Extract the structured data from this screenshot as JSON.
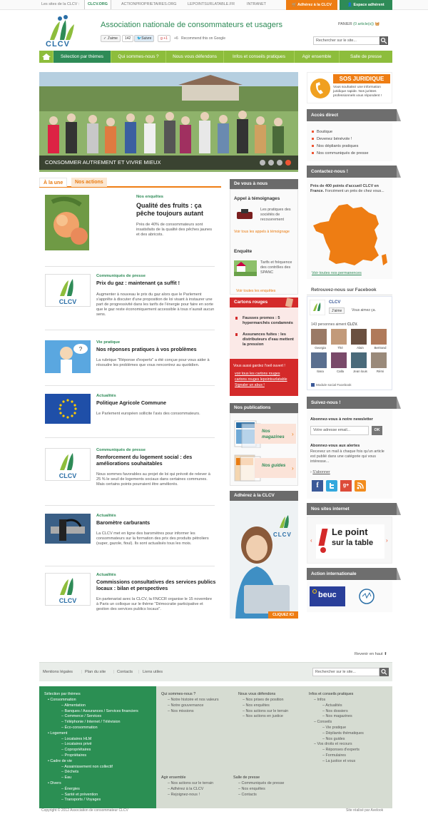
{
  "topbar": {
    "sites_label": "Les sites de la CLCV :",
    "links": [
      "CLCV.ORG",
      "ACTIONPROPRIETAIRES.ORG",
      "LEPOINTSURLATABLE.FR",
      "INTRANET"
    ],
    "adherez": "Adhérez à la CLCV",
    "espace": "Espace adhérent"
  },
  "header": {
    "logo_text": "CLCV",
    "site_title": "Association nationale de consommateurs et usagers",
    "jaime": "J'aime",
    "jaime_count": "142",
    "suivre": "Suivre",
    "gplus": "+1",
    "gplus_count": "+6",
    "recommend": "Recommend this on Google",
    "panier_label": "PANIER",
    "panier_value": "(0 article(s))",
    "search_placeholder": "Rechercher sur le site..."
  },
  "nav": {
    "items": [
      "Sélection par thèmes",
      "Qui sommes-nous ?",
      "Nous vous défendons",
      "Infos et conseils pratiques",
      "Agir ensemble",
      "Salle de presse"
    ]
  },
  "hero": {
    "caption": "CONSOMMER AUTREMENT ET VIVRE MIEUX"
  },
  "tabs": [
    "À la une",
    "Nos actions"
  ],
  "articles": [
    {
      "category": "Nos enquêtes",
      "title": "Qualité des fruits : ça pêche toujours autant",
      "desc": "Près de 40% de consommateurs sont insatisfaits de la qualité des pêches jaunes et des abricots."
    },
    {
      "category": "Communiqués de presse",
      "title": "Prix du gaz : maintenant ça suffit !",
      "desc": "Augmenter à nouveau le prix du gaz alors que le Parlement s'apprête à discuter d'une proposition de loi visant à instaurer une part de progressivité dans les tarifs de l'énergie pour faire en sorte que le gaz reste économiquement accessible à tous n'aurait aucun sens."
    },
    {
      "category": "Vie pratique",
      "title": "Nos réponses pratiques à vos problèmes",
      "desc": "La rubrique \"Réponse d'experts\" a été conçue pour vous aider à résoudre les problèmes que vous rencontrez au quotidien."
    },
    {
      "category": "Actualités",
      "title": "Politique Agricole Commune",
      "desc": "Le Parlement européen sollicite l'avis des consommateurs."
    },
    {
      "category": "Communiqués de presse",
      "title": "Renforcement du logement social : des améliorations souhaitables",
      "desc": "Nous sommes favorables au projet de loi qui prévoit de relever à 25 % le seuil de logements sociaux dans certaines communes. Mais certains points pourraient être améliorés."
    },
    {
      "category": "Actualités",
      "title": "Baromètre carburants",
      "desc": "La CLCV met en ligne des baromètres pour informer les consommateurs sur la formation des prix des produits pétroliers (super, gazole, fioul). Ils sont actualisés tous les mois."
    },
    {
      "category": "Actualités",
      "title": "Commissions consultatives des services publics locaux : bilan et perspectives",
      "desc": "En partenariat avec la CLCV, la FNCCR organise le 15 novembre à Paris un colloque sur le thème \"Démocratie participative et gestion des services publics locaux\"."
    }
  ],
  "de_vous": {
    "heading": "De vous à nous",
    "appel_title": "Appel à témoignages",
    "appel_text": "Les pratiques des sociétés de recouvrement",
    "appel_link": "Voir tous les appels à témoignage",
    "enquete_title": "Enquête",
    "enquete_text": "Tarifs et fréquence des contrôles des SPANC",
    "enquete_link": "Voir toutes les enquêtes"
  },
  "cartons": {
    "heading": "Cartons rouges",
    "items": [
      "Fausses promos : 5 hypermarchés condamnés",
      "Assurances fuites : les distributeurs d'eau mettent la pression"
    ],
    "note": "Vous aussi gardez l'oeil ouvert !",
    "links": [
      "voir tous les cartons rouges",
      "cartons rouges lepointsurlatable",
      "Signaler un abus !"
    ]
  },
  "publications": {
    "heading": "Nos publications",
    "items": [
      "Nos magazines",
      "Nos guides"
    ]
  },
  "adherez_box": {
    "heading": "Adhérez à la CLCV",
    "logo": "CLCV",
    "cta": "CLIQUEZ ICI"
  },
  "sos": {
    "title": "SOS JURIDIQUE",
    "text": "Vous souhaitez une information juridique rapide. Nos juristes professionnels vous répondent !"
  },
  "acces": {
    "heading": "Accès direct",
    "items": [
      "Boutique",
      "Devenez bénévole !",
      "Nos dépliants pratiques",
      "Nos communiqués de presse"
    ]
  },
  "contact": {
    "heading": "Contactez-nous !",
    "text_bold": "Près de 400 points d'accueil CLCV en France.",
    "text": "Forcément un près de chez vous...",
    "link": "Voir toutes nos permanences"
  },
  "facebook": {
    "heading": "Retrouvez-nous sur Facebook",
    "page_name": "CLCV",
    "like": "J'aime",
    "vous_aimez": "Vous aimez ça.",
    "count_text": "143 personnes aiment",
    "count_name": "CLCV.",
    "names": [
      "Georgia",
      "Thé",
      "Alain",
      "Bertrand",
      "Ilana",
      "Calla",
      "Jean louis",
      "Rémi"
    ],
    "module": "Module social Facebook"
  },
  "suivez": {
    "heading": "Suivez-nous !",
    "newsletter_title": "Abonnez-vous à notre newsletter",
    "email_placeholder": "Votre adresse email...",
    "ok": "OK",
    "alertes_title": "Abonnez-vous aux alertes",
    "alertes_text": "Recevez un mail à chaque fois qu'un article est publié dans une catégorie qui vous intéresse...",
    "sabonner": "S'abonner"
  },
  "sites": {
    "heading": "Nos sites internet",
    "point_line1": "Le point",
    "point_line2": "sur la table"
  },
  "international": {
    "heading": "Action internationale",
    "beuc": "beuc"
  },
  "revenir": "Revenir en haut",
  "footer_links": {
    "items": [
      "Mentions légales",
      "Plan du site",
      "Contacts",
      "Liens utiles"
    ],
    "search_placeholder": "Rechercher sur le site..."
  },
  "footer_map": {
    "themes_title": "Sélection par thèmes",
    "themes": [
      {
        "label": "Consommation",
        "level": 1
      },
      {
        "label": "Alimentation",
        "level": 2
      },
      {
        "label": "Banques / Assurances / Services financiers",
        "level": 2
      },
      {
        "label": "Commerce / Services",
        "level": 2
      },
      {
        "label": "Téléphonie / Internet / Télévision",
        "level": 2
      },
      {
        "label": "Éco-consommation",
        "level": 2
      },
      {
        "label": "Logement",
        "level": 1
      },
      {
        "label": "Locataires HLM",
        "level": 2
      },
      {
        "label": "Locataires privé",
        "level": 2
      },
      {
        "label": "Copropriétaires",
        "level": 2
      },
      {
        "label": "Propriétaires",
        "level": 2
      },
      {
        "label": "Cadre de vie",
        "level": 1
      },
      {
        "label": "Assainissement non collectif",
        "level": 2
      },
      {
        "label": "Déchets",
        "level": 2
      },
      {
        "label": "Eau",
        "level": 2
      },
      {
        "label": "Divers",
        "level": 1
      },
      {
        "label": "Énergies",
        "level": 2
      },
      {
        "label": "Santé et prévention",
        "level": 2
      },
      {
        "label": "Transports / Voyages",
        "level": 2
      }
    ],
    "qui_title": "Qui sommes-nous ?",
    "qui": [
      "Notre histoire et nos valeurs",
      "Notre gouvernance",
      "Nos missions"
    ],
    "defendons_title": "Nous vous défendons",
    "defendons": [
      "Nos prises de position",
      "Nos enquêtes",
      "Nos actions sur le terrain",
      "Nos actions en justice"
    ],
    "infos_title": "Infos et conseils pratiques",
    "infos": [
      {
        "label": "Infos",
        "level": 1
      },
      {
        "label": "Actualités",
        "level": 2
      },
      {
        "label": "Nos dossiers",
        "level": 2
      },
      {
        "label": "Nos magazines",
        "level": 2
      },
      {
        "label": "Conseils",
        "level": 1
      },
      {
        "label": "Vie pratique",
        "level": 2
      },
      {
        "label": "Dépliants thématiques",
        "level": 2
      },
      {
        "label": "Nos guides",
        "level": 2
      },
      {
        "label": "Vos droits et recours",
        "level": 1
      },
      {
        "label": "Réponses d'experts",
        "level": 2
      },
      {
        "label": "Formulaires",
        "level": 2
      },
      {
        "label": "La justice et vous",
        "level": 2
      }
    ],
    "agir_title": "Agir ensemble",
    "agir": [
      "Nos actions sur le terrain",
      "Adhérez à la CLCV",
      "Rejoignez-nous !"
    ],
    "presse_title": "Salle de presse",
    "presse": [
      "Communiqués de presse",
      "Nos enquêtes",
      "Contacts"
    ]
  },
  "copyright": "Copyright © 2012 Association de consommateur CLCV",
  "realise": "Site réalisé par Avelook"
}
